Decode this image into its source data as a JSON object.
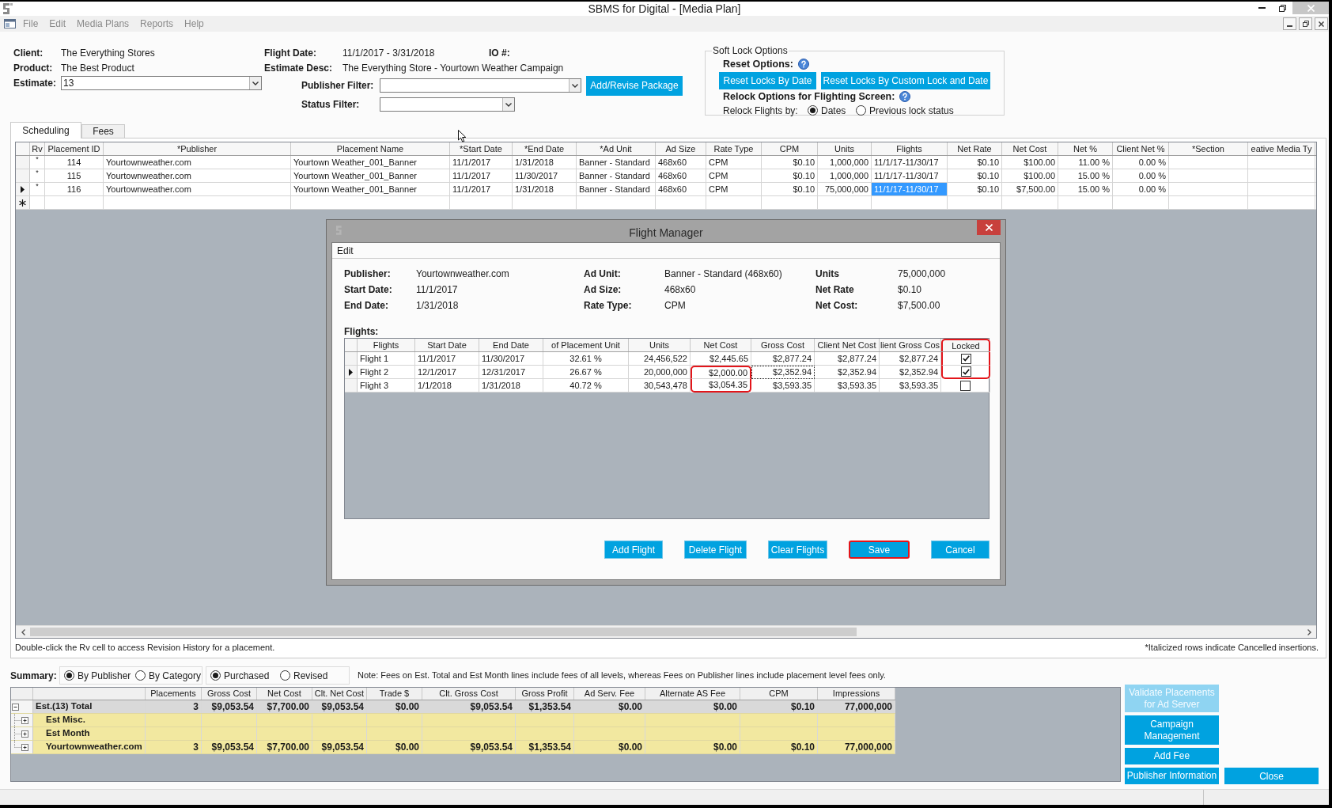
{
  "window": {
    "title": "SBMS for Digital - [Media Plan]"
  },
  "menu": [
    {
      "label": "File",
      "disabled": true
    },
    {
      "label": "Edit",
      "disabled": true
    },
    {
      "label": "Media Plans",
      "disabled": true
    },
    {
      "label": "Reports",
      "disabled": true
    },
    {
      "label": "Help",
      "disabled": true
    }
  ],
  "header": {
    "client": {
      "label": "Client:",
      "value": "The Everything Stores"
    },
    "product": {
      "label": "Product:",
      "value": "The Best Product"
    },
    "estimate": {
      "label": "Estimate:",
      "value": "13"
    },
    "flight_date": {
      "label": "Flight Date:",
      "value": "11/1/2017 - 3/31/2018"
    },
    "io_number": {
      "label": "IO #:"
    },
    "estimate_desc": {
      "label": "Estimate Desc:",
      "value": "The Everything Store - Yourtown Weather Campaign"
    },
    "publisher_filter": {
      "label": "Publisher Filter:"
    },
    "status_filter": {
      "label": "Status Filter:"
    },
    "add_revise_button": {
      "label": "Add/Revise Package"
    }
  },
  "soft_lock": {
    "title": "Soft Lock Options",
    "reset_label": "Reset Options:",
    "reset_buttons": [
      {
        "label": "Reset Locks By Date"
      },
      {
        "label": "Reset Locks By Custom Lock and Date"
      }
    ],
    "relock_label": "Relock Options for Flighting Screen:",
    "relock_by_label": "Relock Flights by:",
    "relock_options": [
      {
        "label": "Dates",
        "selected": true
      },
      {
        "label": "Previous lock status",
        "selected": false
      }
    ]
  },
  "tabs": [
    {
      "label": "Scheduling",
      "selected": true
    },
    {
      "label": "Fees",
      "selected": false
    }
  ],
  "placements_grid": {
    "columns": [
      "Rv",
      "Placement ID",
      "*Publisher",
      "Placement Name",
      "*Start Date",
      "*End Date",
      "*Ad Unit",
      "Ad Size",
      "Rate Type",
      "CPM",
      "Units",
      "Flights",
      "Net Rate",
      "Net Cost",
      "Net %",
      "Client Net %",
      "*Section",
      "eative Media Ty"
    ],
    "rows": [
      {
        "current": false,
        "flights_cell_selected": false,
        "cells": [
          "*",
          "114",
          "Yourtownweather.com",
          "Yourtown Weather_001_Banner",
          "11/1/2017",
          "1/31/2018",
          "Banner - Standard",
          "468x60",
          "CPM",
          "$0.10",
          "1,000,000",
          "11/1/17-11/30/17",
          "$0.10",
          "$100.00",
          "11.00 %",
          "0.00 %"
        ]
      },
      {
        "current": false,
        "flights_cell_selected": false,
        "cells": [
          "*",
          "115",
          "Yourtownweather.com",
          "Yourtown Weather_001_Banner",
          "11/1/2017",
          "11/30/2017",
          "Banner - Standard",
          "468x60",
          "CPM",
          "$0.10",
          "1,000,000",
          "11/1/17-11/30/17",
          "$0.10",
          "$100.00",
          "15.00 %",
          "0.00 %"
        ]
      },
      {
        "current": true,
        "flights_cell_selected": true,
        "cells": [
          "*",
          "116",
          "Yourtownweather.com",
          "Yourtown Weather_001_Banner",
          "11/1/2017",
          "1/31/2018",
          "Banner - Standard",
          "468x60",
          "CPM",
          "$0.10",
          "75,000,000",
          "11/1/17-11/30/17",
          "$0.10",
          "$7,500.00",
          "15.00 %",
          "0.00 %"
        ]
      }
    ]
  },
  "grid_hint": "Double-click the Rv cell to access Revision History for a placement.",
  "cancelled_note": "*Italicized rows indicate Cancelled insertions.",
  "summary": {
    "label": "Summary:",
    "group_by": [
      {
        "label": "By Publisher",
        "selected": true
      },
      {
        "label": "By Category",
        "selected": false
      }
    ],
    "mode": [
      {
        "label": "Purchased",
        "selected": true
      },
      {
        "label": "Revised",
        "selected": false
      }
    ],
    "note": "Note: Fees on Est. Total and Est Month lines include fees of all levels, whereas Fees on Publisher lines include placement level fees only.",
    "columns": [
      "Placements",
      "Gross Cost",
      "Net Cost",
      "Clt. Net Cost",
      "Trade $",
      "Clt. Gross Cost",
      "Gross Profit",
      "Ad Serv. Fee",
      "Alternate AS Fee",
      "CPM",
      "Impressions"
    ],
    "rows": [
      {
        "kind": "total",
        "name": "Est.(13) Total",
        "expanded": true,
        "cells": [
          "3",
          "$9,053.54",
          "$7,700.00",
          "$9,053.54",
          "$0.00",
          "$9,053.54",
          "$1,353.54",
          "$0.00",
          "$0.00",
          "$0.10",
          "77,000,000"
        ],
        "children": [
          {
            "kind": "detail",
            "name": "Est Misc.",
            "expanded": false
          },
          {
            "kind": "detail",
            "name": "Est Month",
            "expanded": false
          },
          {
            "kind": "detail",
            "name": "Yourtownweather.com",
            "expanded": false,
            "cells": [
              "3",
              "$9,053.54",
              "$7,700.00",
              "$9,053.54",
              "$0.00",
              "$9,053.54",
              "$1,353.54",
              "$0.00",
              "$0.00",
              "$0.10",
              "77,000,000"
            ]
          }
        ]
      }
    ]
  },
  "side_buttons": [
    {
      "label": "Validate Placements for Ad Server",
      "disabled": true
    },
    {
      "label": "Campaign Management",
      "disabled": false
    },
    {
      "label": "Add Fee",
      "disabled": false
    },
    {
      "label": "Publisher Information",
      "disabled": false
    }
  ],
  "close_button": {
    "label": "Close"
  },
  "dialog": {
    "title": "Flight Manager",
    "menu": [
      {
        "label": "Edit"
      }
    ],
    "info_columns": [
      {
        "fields": [
          {
            "label": "Publisher:",
            "value": "Yourtownweather.com"
          },
          {
            "label": "Start Date:",
            "value": "11/1/2017"
          },
          {
            "label": "End Date:",
            "value": "1/31/2018"
          }
        ]
      },
      {
        "fields": [
          {
            "label": "Ad Unit:",
            "value": "Banner - Standard (468x60)"
          },
          {
            "label": "Ad Size:",
            "value": "468x60"
          },
          {
            "label": "Rate Type:",
            "value": "CPM"
          }
        ]
      },
      {
        "fields": [
          {
            "label": "Units",
            "value": "75,000,000"
          },
          {
            "label": "Net Rate",
            "value": "$0.10"
          },
          {
            "label": "Net Cost:",
            "value": "$7,500.00"
          }
        ]
      }
    ],
    "flights_label": "Flights:",
    "flights": {
      "columns": [
        "Flights",
        "Start Date",
        "End Date",
        "of Placement Unit",
        "Units",
        "Net Cost",
        "Gross Cost",
        "Client Net Cost",
        "lient Gross Cos",
        "Locked"
      ],
      "locked_header_marked": true,
      "rows": [
        {
          "cells": [
            "Flight 1",
            "11/1/2017",
            "11/30/2017",
            "32.61 %",
            "24,456,522",
            "$2,445.65",
            "$2,877.24",
            "$2,877.24",
            "$2,877.24"
          ],
          "locked": true,
          "current": false,
          "gross_cost_focused": false,
          "net_cost_marked": false,
          "locked_marked": true
        },
        {
          "cells": [
            "Flight 2",
            "12/1/2017",
            "12/31/2017",
            "26.67 %",
            "20,000,000",
            "$2,000.00",
            "$2,352.94",
            "$2,352.94",
            "$2,352.94"
          ],
          "locked": true,
          "current": true,
          "gross_cost_focused": true,
          "net_cost_marked": true,
          "locked_marked": true
        },
        {
          "cells": [
            "Flight 3",
            "1/1/2018",
            "1/31/2018",
            "40.72 %",
            "30,543,478",
            "$3,054.35",
            "$3,593.35",
            "$3,593.35",
            "$3,593.35"
          ],
          "locked": false,
          "current": false,
          "gross_cost_focused": false,
          "net_cost_marked": true,
          "locked_marked": false
        }
      ]
    },
    "buttons": [
      {
        "label": "Add Flight",
        "marked": false
      },
      {
        "label": "Delete Flight",
        "marked": false
      },
      {
        "label": "Clear Flights",
        "marked": false
      },
      {
        "label": "Save",
        "marked": true
      },
      {
        "label": "Cancel",
        "marked": false
      }
    ]
  }
}
